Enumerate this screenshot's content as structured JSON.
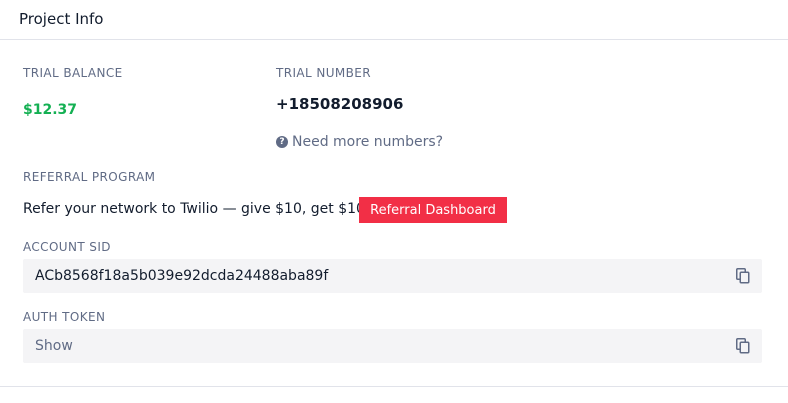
{
  "header": {
    "title": "Project Info"
  },
  "trial_balance": {
    "label": "TRIAL BALANCE",
    "value": "$12.37"
  },
  "trial_number": {
    "label": "TRIAL NUMBER",
    "value": "+18508208906",
    "more_link": "Need more numbers?",
    "help_glyph": "?"
  },
  "referral": {
    "label": "REFERRAL PROGRAM",
    "text": "Refer your network to Twilio — give $10, get $10.",
    "button_label": "Referral Dashboard"
  },
  "account_sid": {
    "label": "ACCOUNT SID",
    "value": "ACb8568f18a5b039e92dcda24488aba89f"
  },
  "auth_token": {
    "label": "AUTH TOKEN",
    "value": "Show"
  },
  "icons": {
    "copy": "copy-icon",
    "help": "question-circle-icon"
  },
  "colors": {
    "balance": "#14b053",
    "accent_button": "#f22f46",
    "field_background": "#f4f4f6",
    "label": "#606b85",
    "text": "#121c2d"
  }
}
